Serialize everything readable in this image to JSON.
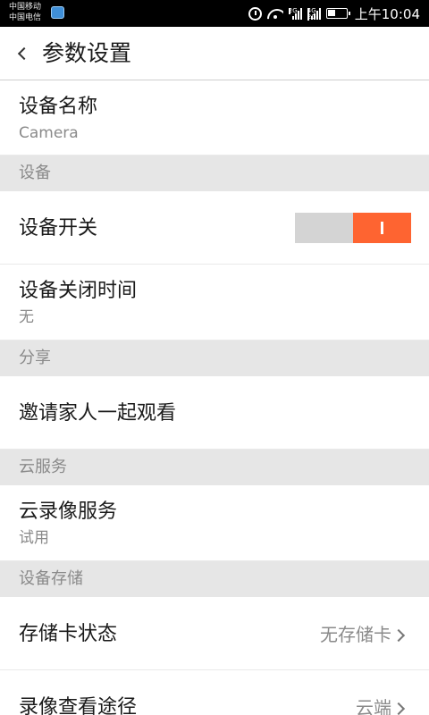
{
  "status_bar": {
    "carrier_1": "中国移动",
    "carrier_2": "中国电信",
    "net_1": "2G",
    "net_2": "4G",
    "net_3": "2G",
    "time": "上午10:04"
  },
  "header": {
    "title": "参数设置"
  },
  "device_name": {
    "label": "设备名称",
    "value": "Camera"
  },
  "sections": {
    "device": "设备",
    "share": "分享",
    "cloud": "云服务",
    "storage": "设备存储"
  },
  "device_switch": {
    "label": "设备开关",
    "state": "on",
    "accent_color": "#fe6431"
  },
  "device_off_time": {
    "label": "设备关闭时间",
    "value": "无"
  },
  "invite": {
    "label": "邀请家人一起观看"
  },
  "cloud_recording": {
    "label": "云录像服务",
    "value": "试用"
  },
  "sd_status": {
    "label": "存储卡状态",
    "value": "无存储卡"
  },
  "playback_path": {
    "label": "录像查看途径",
    "value": "云端"
  }
}
